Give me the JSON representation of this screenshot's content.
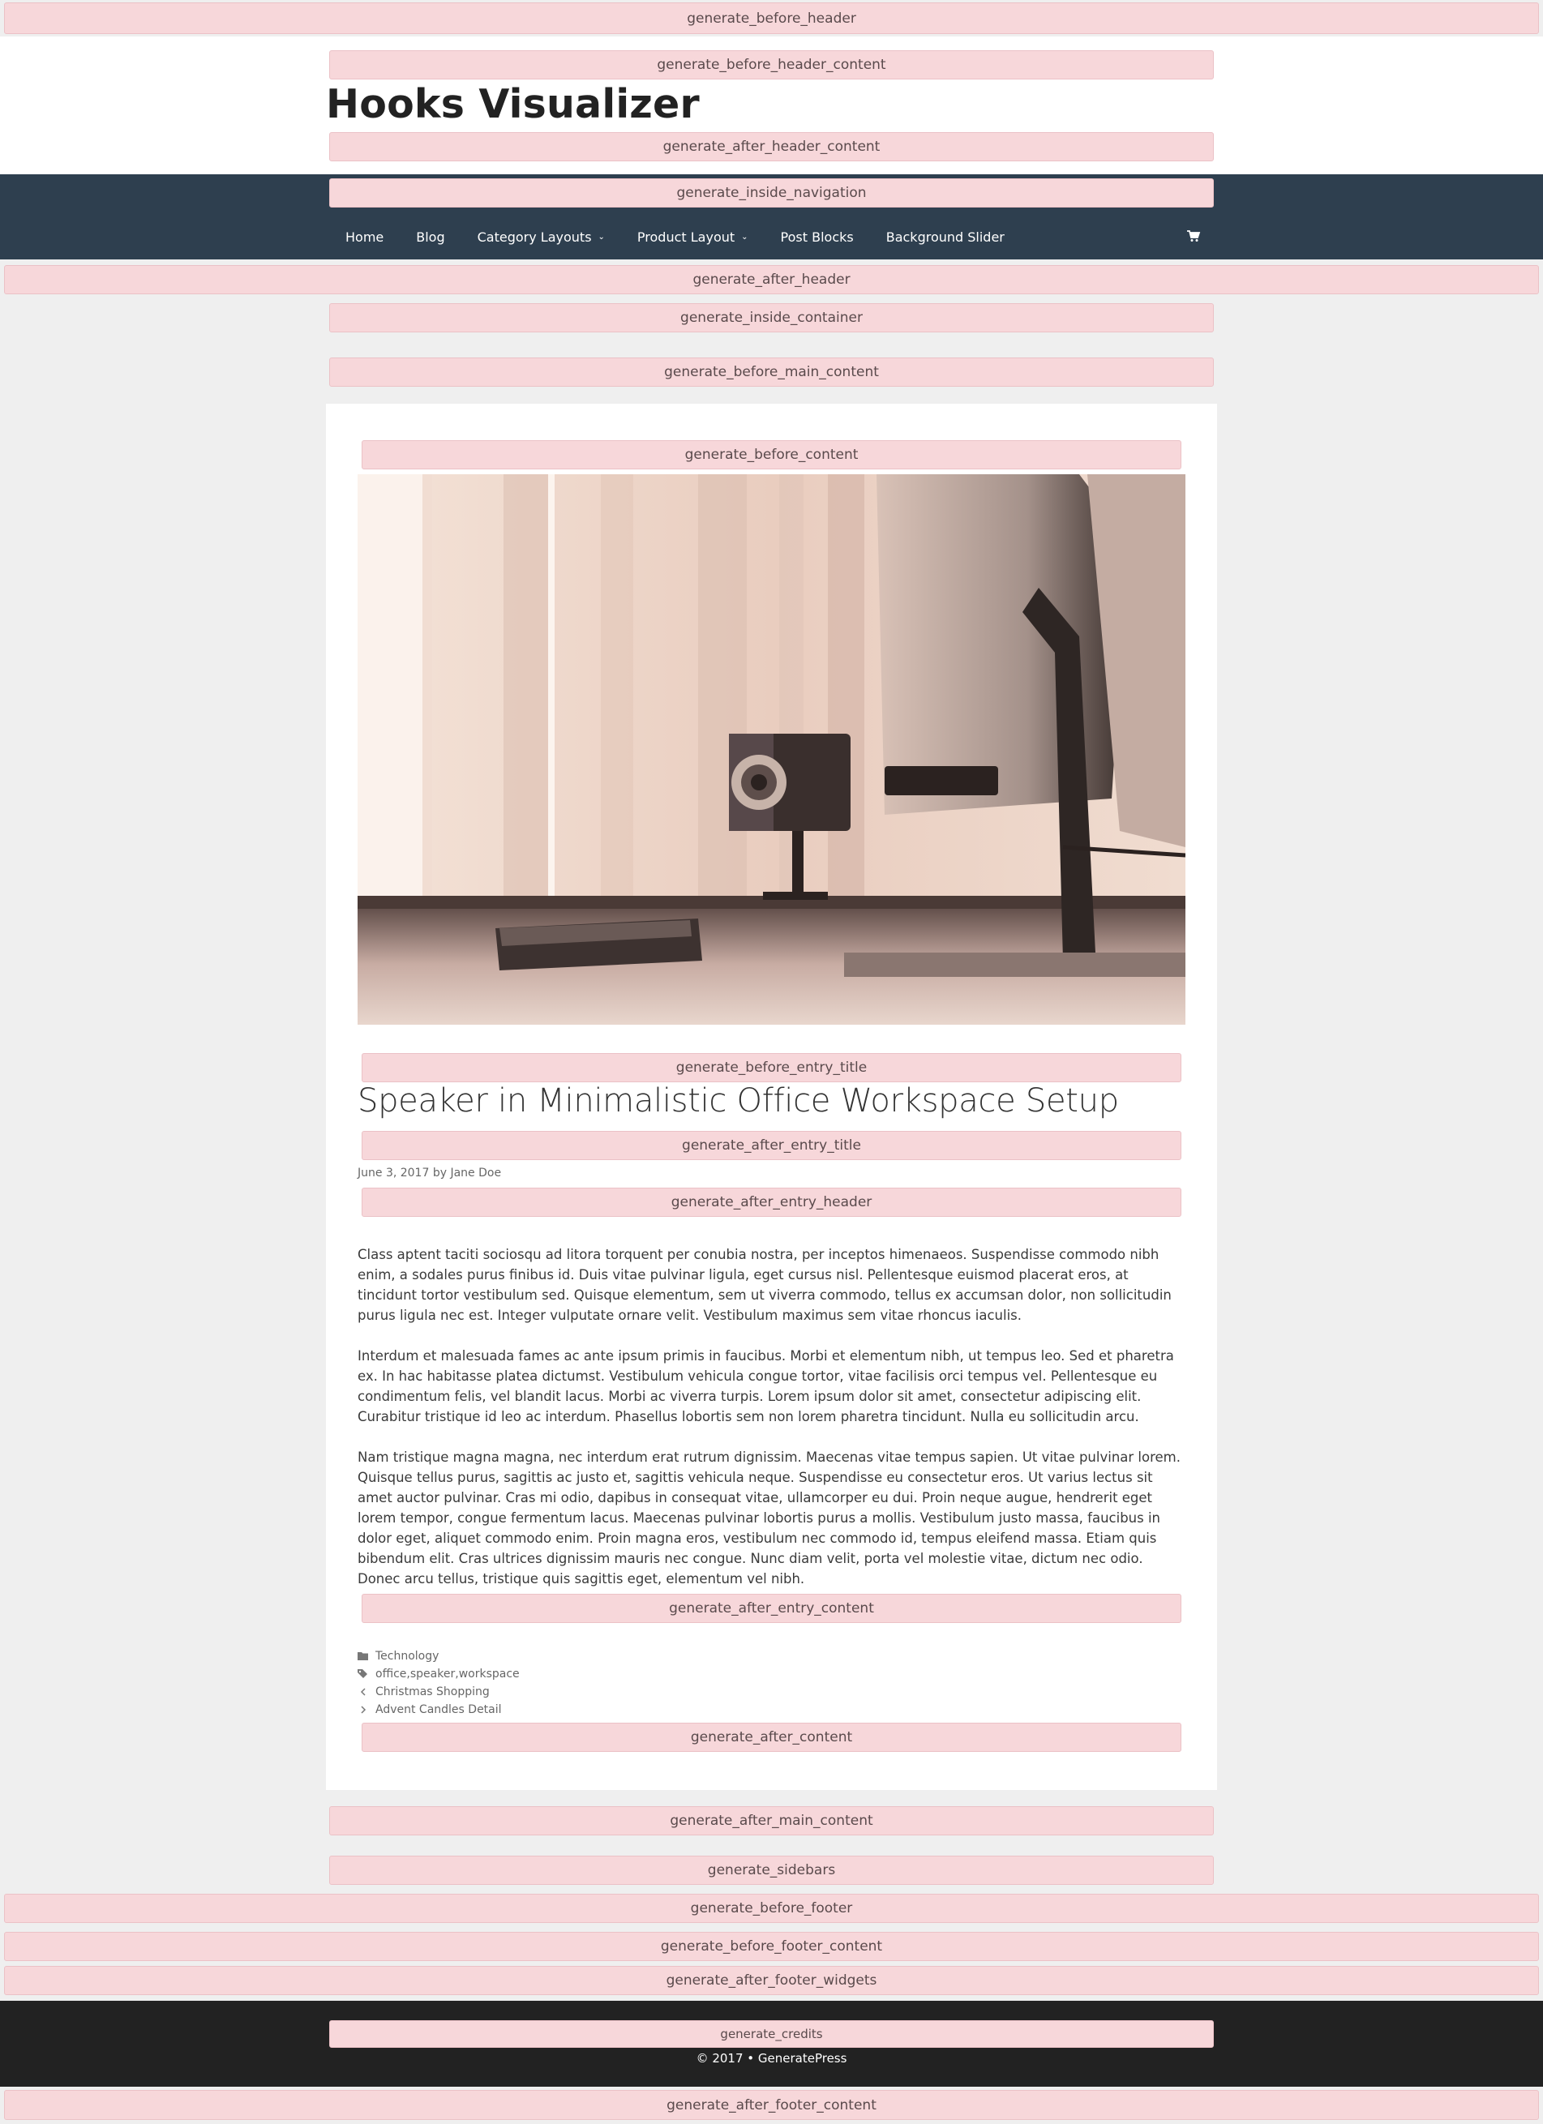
{
  "hooks": {
    "before_header": "generate_before_header",
    "before_header_content": "generate_before_header_content",
    "after_header_content": "generate_after_header_content",
    "inside_navigation": "generate_inside_navigation",
    "after_header": "generate_after_header",
    "inside_container": "generate_inside_container",
    "before_main_content": "generate_before_main_content",
    "before_content": "generate_before_content",
    "before_entry_title": "generate_before_entry_title",
    "after_entry_title": "generate_after_entry_title",
    "after_entry_header": "generate_after_entry_header",
    "after_entry_content": "generate_after_entry_content",
    "after_content": "generate_after_content",
    "after_main_content": "generate_after_main_content",
    "sidebars": "generate_sidebars",
    "before_footer": "generate_before_footer",
    "before_footer_content": "generate_before_footer_content",
    "after_footer_widgets": "generate_after_footer_widgets",
    "credits": "generate_credits",
    "after_footer_content": "generate_after_footer_content"
  },
  "site": {
    "title": "Hooks Visualizer"
  },
  "nav": {
    "items": [
      {
        "label": "Home"
      },
      {
        "label": "Blog"
      },
      {
        "label": "Category Layouts"
      },
      {
        "label": "Product Layout"
      },
      {
        "label": "Post Blocks"
      },
      {
        "label": "Background Slider"
      }
    ],
    "cart_icon": "shopping-cart-icon"
  },
  "post": {
    "title": "Speaker in Minimalistic Office Workspace Setup",
    "date": "June 3, 2017",
    "by": "by",
    "author": "Jane Doe",
    "paragraphs": [
      "Class aptent taciti sociosqu ad litora torquent per conubia nostra, per inceptos himenaeos. Suspendisse commodo nibh enim, a sodales purus finibus id. Duis vitae pulvinar ligula, eget cursus nisl. Pellentesque euismod placerat eros, at tincidunt tortor vestibulum sed. Quisque elementum, sem ut viverra commodo, tellus ex accumsan dolor, non sollicitudin purus ligula nec est. Integer vulputate ornare velit. Vestibulum maximus sem vitae rhoncus iaculis.",
      "Interdum et malesuada fames ac ante ipsum primis in faucibus. Morbi et elementum nibh, ut tempus leo. Sed et pharetra ex. In hac habitasse platea dictumst. Vestibulum vehicula congue tortor, vitae facilisis orci tempus vel. Pellentesque eu condimentum felis, vel blandit lacus. Morbi ac viverra turpis. Lorem ipsum dolor sit amet, consectetur adipiscing elit. Curabitur tristique id leo ac interdum. Phasellus lobortis sem non lorem pharetra tincidunt. Nulla eu sollicitudin arcu.",
      "Nam tristique magna magna, nec interdum erat rutrum dignissim. Maecenas vitae tempus sapien. Ut vitae pulvinar lorem. Quisque tellus purus, sagittis ac justo et, sagittis vehicula neque. Suspendisse eu consectetur eros. Ut varius lectus sit amet auctor pulvinar. Cras mi odio, dapibus in consequat vitae, ullamcorper eu dui. Proin neque augue, hendrerit eget lorem tempor, congue fermentum lacus. Maecenas pulvinar lobortis purus a mollis. Vestibulum justo massa, faucibus in dolor eget, aliquet commodo enim. Proin magna eros, vestibulum nec commodo id, tempus eleifend massa. Etiam quis bibendum elit. Cras ultrices dignissim mauris nec congue. Nunc diam velit, porta vel molestie vitae, dictum nec odio. Donec arcu tellus, tristique quis sagittis eget, elementum vel nibh."
    ],
    "category": "Technology",
    "tags": [
      "office",
      "speaker",
      "workspace"
    ],
    "tag_separator": ", ",
    "prev_post": "Christmas Shopping",
    "next_post": "Advent Candles Detail"
  },
  "footer": {
    "copyright": "© 2017 • GeneratePress"
  },
  "colors": {
    "hook_bg": "#f7d7da",
    "nav_bg": "#2e3f4f",
    "footer_bg": "#222222",
    "page_bg": "#efefef"
  }
}
